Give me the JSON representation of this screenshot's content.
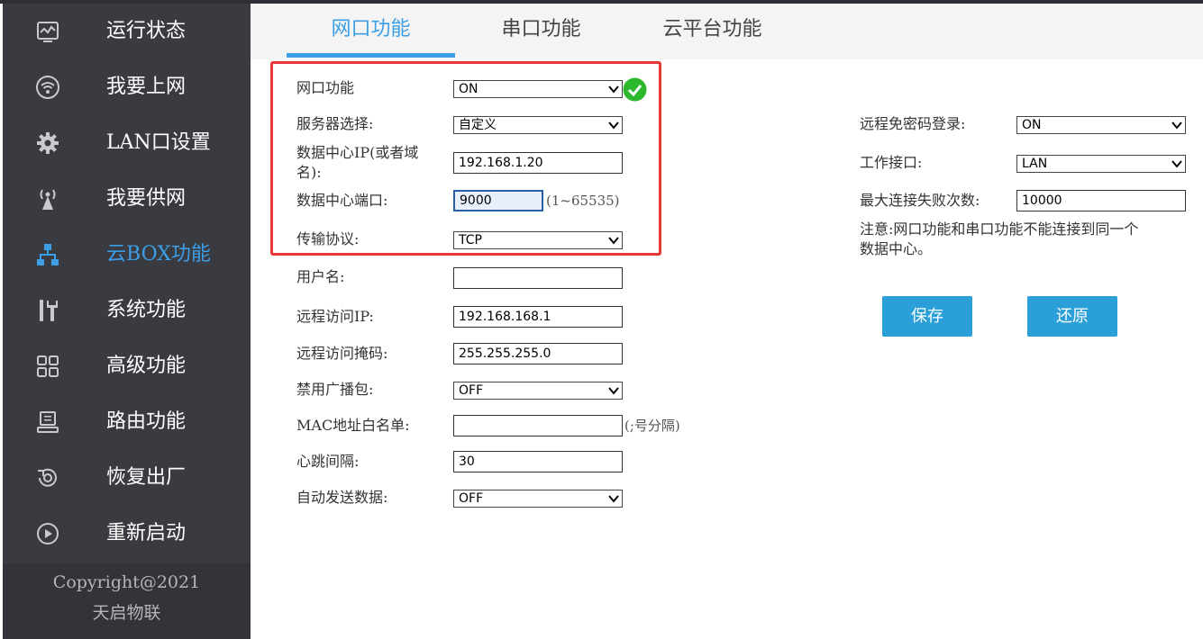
{
  "sidebar": {
    "items": [
      {
        "label": "运行状态",
        "icon": "monitor-chart-icon"
      },
      {
        "label": "我要上网",
        "icon": "wifi-icon"
      },
      {
        "label": "LAN口设置",
        "icon": "gear-icon"
      },
      {
        "label": "我要供网",
        "icon": "antenna-icon"
      },
      {
        "label": "云BOX功能",
        "icon": "network-tree-icon",
        "active": true
      },
      {
        "label": "系统功能",
        "icon": "tools-icon"
      },
      {
        "label": "高级功能",
        "icon": "grid-icon"
      },
      {
        "label": "路由功能",
        "icon": "router-icon"
      },
      {
        "label": "恢复出厂",
        "icon": "restore-icon"
      },
      {
        "label": "重新启动",
        "icon": "restart-icon"
      }
    ],
    "copyright_line1": "Copyright@2021",
    "copyright_line2": "天启物联"
  },
  "tabs": [
    {
      "label": "网口功能",
      "active": true
    },
    {
      "label": "串口功能"
    },
    {
      "label": "云平台功能"
    }
  ],
  "form": {
    "net_func_label": "网口功能",
    "net_func_value": "ON",
    "server_label": "服务器选择:",
    "server_value": "自定义",
    "dc_ip_label_1": "数据中心IP(或者域",
    "dc_ip_label_2": "名):",
    "dc_ip_value": "192.168.1.20",
    "dc_port_label": "数据中心端口:",
    "dc_port_value": "9000",
    "dc_port_hint": "(1~65535)",
    "protocol_label": "传输协议:",
    "protocol_value": "TCP",
    "username_label": "用户名:",
    "username_value": "",
    "remote_ip_label": "远程访问IP:",
    "remote_ip_value": "192.168.168.1",
    "remote_mask_label": "远程访问掩码:",
    "remote_mask_value": "255.255.255.0",
    "broadcast_label": "禁用广播包:",
    "broadcast_value": "OFF",
    "mac_label": "MAC地址白名单:",
    "mac_value": "",
    "mac_hint": "(;号分隔)",
    "heartbeat_label": "心跳间隔:",
    "heartbeat_value": "30",
    "autosend_label": "自动发送数据:",
    "autosend_value": "OFF"
  },
  "right": {
    "nopwd_label": "远程免密码登录:",
    "nopwd_value": "ON",
    "iface_label": "工作接口:",
    "iface_value": "LAN",
    "maxfail_label": "最大连接失败次数:",
    "maxfail_value": "10000",
    "note_line1": "注意:网口功能和串口功能不能连接到同一个",
    "note_line2": "数据中心。",
    "save_label": "保存",
    "restore_label": "还原"
  },
  "colors": {
    "accent": "#3b9ee6",
    "button": "#2a9fd8",
    "highlight_box": "#e53935",
    "ok": "#2eb82e"
  }
}
